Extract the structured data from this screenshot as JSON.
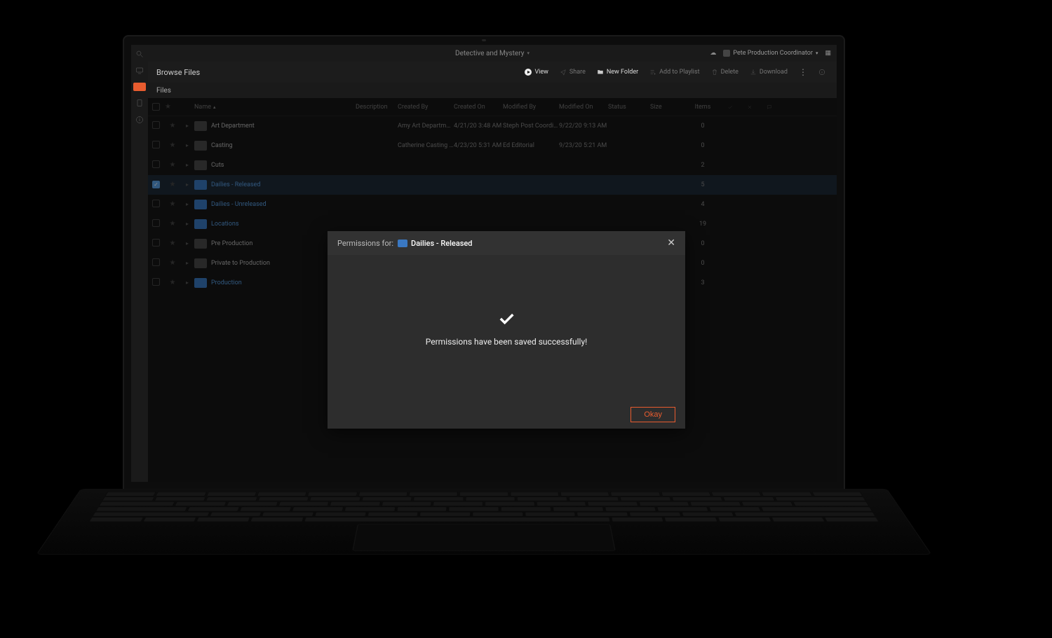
{
  "topbar": {
    "project_title": "Detective and Mystery",
    "user_name": "Pete Production Coordinator"
  },
  "toolbar": {
    "page_title": "Browse Files",
    "view": "View",
    "share": "Share",
    "new_folder": "New Folder",
    "add_to_playlist": "Add to Playlist",
    "delete": "Delete",
    "download": "Download"
  },
  "subbar": {
    "files": "Files"
  },
  "columns": {
    "name": "Name",
    "description": "Description",
    "created_by": "Created By",
    "created_on": "Created On",
    "modified_by": "Modified By",
    "modified_on": "Modified On",
    "status": "Status",
    "size": "Size",
    "items": "Items"
  },
  "rows": [
    {
      "name": "Art Department",
      "folder": "gray",
      "link": false,
      "checked": false,
      "created_by": "Amy Art Department",
      "created_on": "4/21/20 3:48 AM",
      "modified_by": "Steph Post Coordinator",
      "modified_on": "9/22/20 9:13 AM",
      "items": "0"
    },
    {
      "name": "Casting",
      "folder": "gray",
      "link": false,
      "checked": false,
      "created_by": "Catherine Casting Dir...",
      "created_on": "4/23/20 5:31 AM",
      "modified_by": "Ed Editorial",
      "modified_on": "9/23/20 5:21 AM",
      "items": "0"
    },
    {
      "name": "Cuts",
      "folder": "gray",
      "link": false,
      "checked": false,
      "created_by": "",
      "created_on": "",
      "modified_by": "",
      "modified_on": "",
      "items": "2"
    },
    {
      "name": "Dailies - Released",
      "folder": "blue",
      "link": true,
      "checked": true,
      "created_by": "",
      "created_on": "",
      "modified_by": "",
      "modified_on": "",
      "items": "5"
    },
    {
      "name": "Dailies - Unreleased",
      "folder": "blue",
      "link": true,
      "checked": false,
      "created_by": "",
      "created_on": "",
      "modified_by": "",
      "modified_on": "",
      "items": "4"
    },
    {
      "name": "Locations",
      "folder": "blue",
      "link": true,
      "checked": false,
      "created_by": "",
      "created_on": "",
      "modified_by": "",
      "modified_on": "",
      "items": "19"
    },
    {
      "name": "Pre Production",
      "folder": "gray",
      "link": false,
      "checked": false,
      "created_by": "",
      "created_on": "",
      "modified_by": "",
      "modified_on": "",
      "items": "0"
    },
    {
      "name": "Private to Production",
      "folder": "gray",
      "link": false,
      "checked": false,
      "created_by": "",
      "created_on": "",
      "modified_by": "",
      "modified_on": "",
      "items": "0"
    },
    {
      "name": "Production",
      "folder": "blue",
      "link": true,
      "checked": false,
      "created_by": "",
      "created_on": "",
      "modified_by": "",
      "modified_on": "",
      "items": "3"
    }
  ],
  "modal": {
    "label": "Permissions for:",
    "folder_name": "Dailies - Released",
    "message": "Permissions have been saved successfully!",
    "ok": "Okay"
  }
}
